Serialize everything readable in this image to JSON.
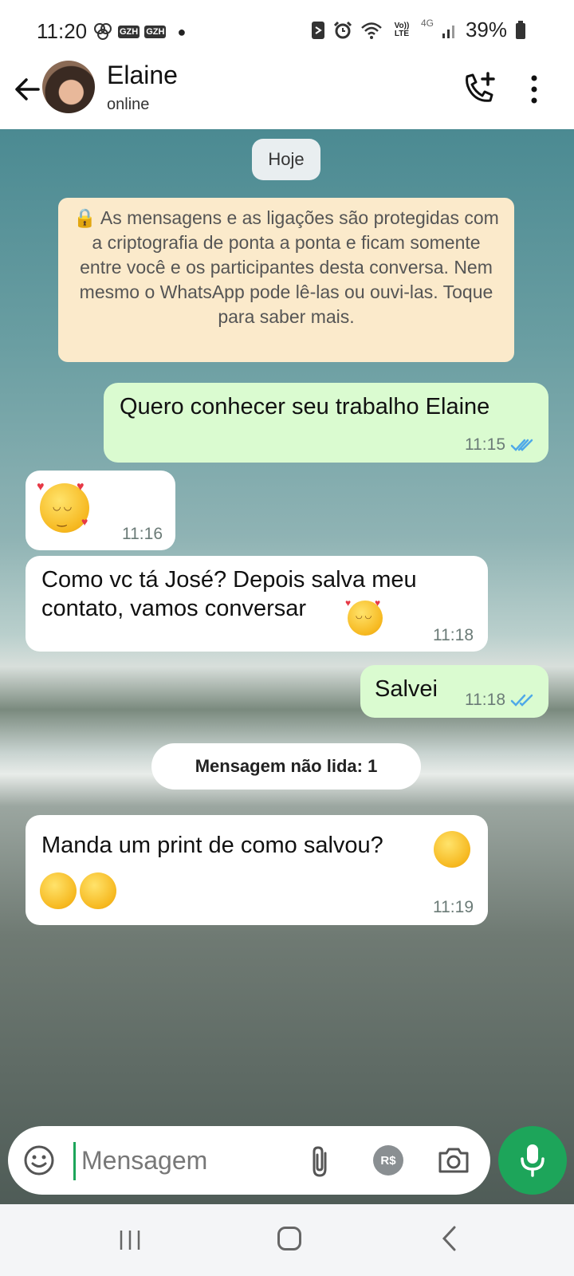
{
  "status_bar": {
    "time": "11:20",
    "battery": "39%",
    "network": "4G",
    "volte": "Vo)) LTE",
    "notif_badges": [
      "GZH",
      "GZH"
    ]
  },
  "header": {
    "name": "Elaine",
    "status": "online"
  },
  "chat": {
    "date_label": "Hoje",
    "encryption_notice": "🔒 As mensagens e as ligações são protegidas com a criptografia de ponta a ponta e ficam somente entre você e os participantes desta conversa. Nem mesmo o WhatsApp pode lê-las ou ouvi-las. Toque para saber mais.",
    "messages": [
      {
        "direction": "out",
        "text": "Quero conhecer seu trabalho Elaine",
        "time": "11:15",
        "status": "read"
      },
      {
        "direction": "in",
        "text": "",
        "emoji": "smiling-face-with-hearts",
        "time": "11:16"
      },
      {
        "direction": "in",
        "text": "Como vc tá José? Depois salva meu contato, vamos conversar",
        "emoji": "smiling-face-with-hearts",
        "time": "11:18"
      },
      {
        "direction": "out",
        "text": "Salvei",
        "time": "11:18",
        "status": "read"
      },
      {
        "direction": "in",
        "text": "Manda um print de como salvou?",
        "emoji": "kissing-face-with-smiling-eyes",
        "time": "11:19"
      }
    ],
    "unread_label": "Mensagem não lida: 1"
  },
  "composer": {
    "placeholder": "Mensagem",
    "pay_label": "R$"
  },
  "colors": {
    "accent": "#1da55a",
    "outgoing_bubble": "#dafbd0",
    "read_tick": "#4fa9e8",
    "notice_bg": "#fbeacb"
  }
}
